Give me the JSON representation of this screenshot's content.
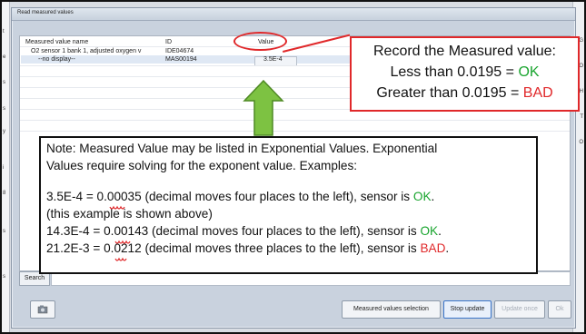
{
  "window": {
    "title": "Read measured values"
  },
  "table": {
    "columns": [
      "Measured value name",
      "ID",
      "Value"
    ],
    "rows": [
      {
        "name": "O2 sensor 1 bank 1, adjusted oxygen v",
        "id": "IDE04674",
        "value": ""
      },
      {
        "name": "--no display--",
        "id": "MAS00194",
        "value": "3.5E-4"
      }
    ]
  },
  "callout": {
    "line1": "Record the Measured value:",
    "line2_prefix": "Less than 0.0195 = ",
    "line2_status": "OK",
    "line3_prefix": "Greater than 0.0195 = ",
    "line3_status": "BAD",
    "colors": {
      "border": "#e0282a",
      "ok": "#1aa52f",
      "bad": "#e0282a"
    }
  },
  "arrow": {
    "color": "#7dc242",
    "direction": "up"
  },
  "note": {
    "line1": "Note:  Measured Value may be listed in Exponential Values.   Exponential",
    "line2": "Values require solving for the exponent value.  Examples:",
    "ex1_main": "3.5E-4 = 0.00035 (decimal moves four places to the left), sensor is ",
    "ex1_status": "OK",
    "ex1_tail": ".",
    "ex1_sub": "(this example is shown above)",
    "ex2_main": "14.3E-4 = 0.00143 (decimal moves four places to the left), sensor is ",
    "ex2_status": "OK",
    "ex2_tail": ".",
    "ex3_main": "21.2E-3 = 0.0212 (decimal moves three places to the left), sensor is ",
    "ex3_status": "BAD",
    "ex3_tail": "."
  },
  "search": {
    "label": "Search",
    "value": ""
  },
  "buttons": {
    "measured_values_selection": "Measured values selection",
    "stop_update": "Stop update",
    "update_once": "Update once",
    "ok": "Ok"
  },
  "icons": {
    "camera_button": "camera-icon"
  },
  "edge_labels": {
    "left": [
      "t",
      "e",
      "s",
      "s",
      "y",
      "i",
      "8",
      "s",
      "s"
    ],
    "right": [
      "G",
      "O",
      "H",
      "T",
      "O"
    ]
  }
}
